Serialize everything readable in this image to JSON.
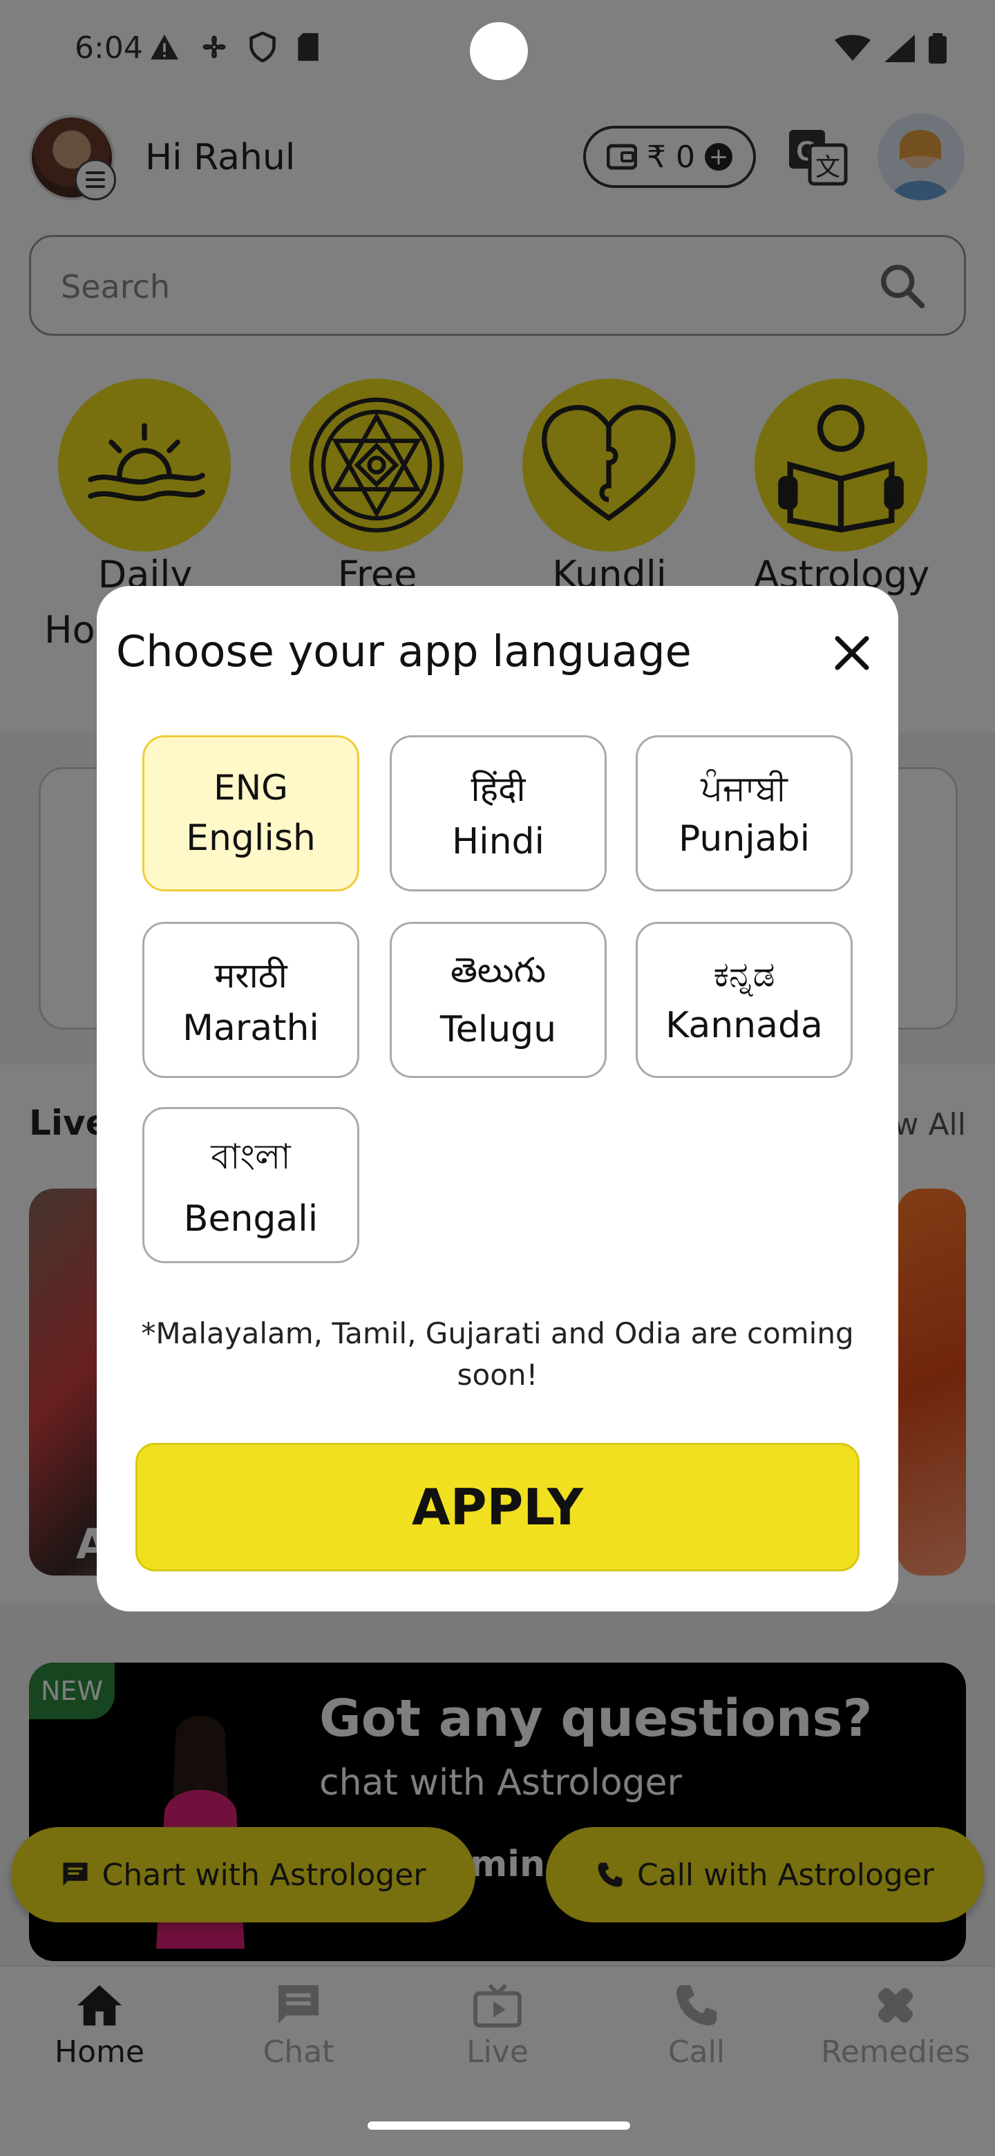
{
  "status_bar": {
    "time": "6:04"
  },
  "header": {
    "greeting": "Hi Rahul",
    "wallet_balance": "₹ 0"
  },
  "search": {
    "placeholder": "Search"
  },
  "features": [
    {
      "label": "Daily",
      "label2": "Ho"
    },
    {
      "label": "Free"
    },
    {
      "label": "Kundli"
    },
    {
      "label": "Astrology"
    }
  ],
  "live_section": {
    "title": "Live",
    "view_all": "w All",
    "card_name": "A"
  },
  "promo": {
    "badge": "NEW",
    "title": "Got any questions?",
    "subtitle": "chat with Astrologer",
    "min_text": "min"
  },
  "cta": {
    "chat_label": "Chart with Astrologer",
    "call_label": "Call with Astrologer"
  },
  "bottom_nav": [
    {
      "label": "Home",
      "icon": "home-icon",
      "active": true
    },
    {
      "label": "Chat",
      "icon": "chat-icon"
    },
    {
      "label": "Live",
      "icon": "tv-icon"
    },
    {
      "label": "Call",
      "icon": "phone-icon"
    },
    {
      "label": "Remedies",
      "icon": "remedies-icon"
    }
  ],
  "dialog": {
    "title": "Choose your app language",
    "languages": [
      {
        "native": "ENG",
        "name": "English",
        "selected": true
      },
      {
        "native": "हिंदी",
        "name": "Hindi"
      },
      {
        "native": "ਪੰਜਾਬੀ",
        "name": "Punjabi"
      },
      {
        "native": "मराठी",
        "name": "Marathi"
      },
      {
        "native": "తెలుగు",
        "name": "Telugu"
      },
      {
        "native": "ಕನ್ನಡ",
        "name": "Kannada"
      },
      {
        "native": "বাংলা",
        "name": "Bengali"
      }
    ],
    "note": "*Malayalam, Tamil, Gujarati and Odia are coming soon!",
    "apply_label": "APPLY"
  },
  "colors": {
    "accent_yellow": "#f0de1f",
    "selected_bg": "#fff8c8",
    "badge_green": "#2e8b3e"
  }
}
